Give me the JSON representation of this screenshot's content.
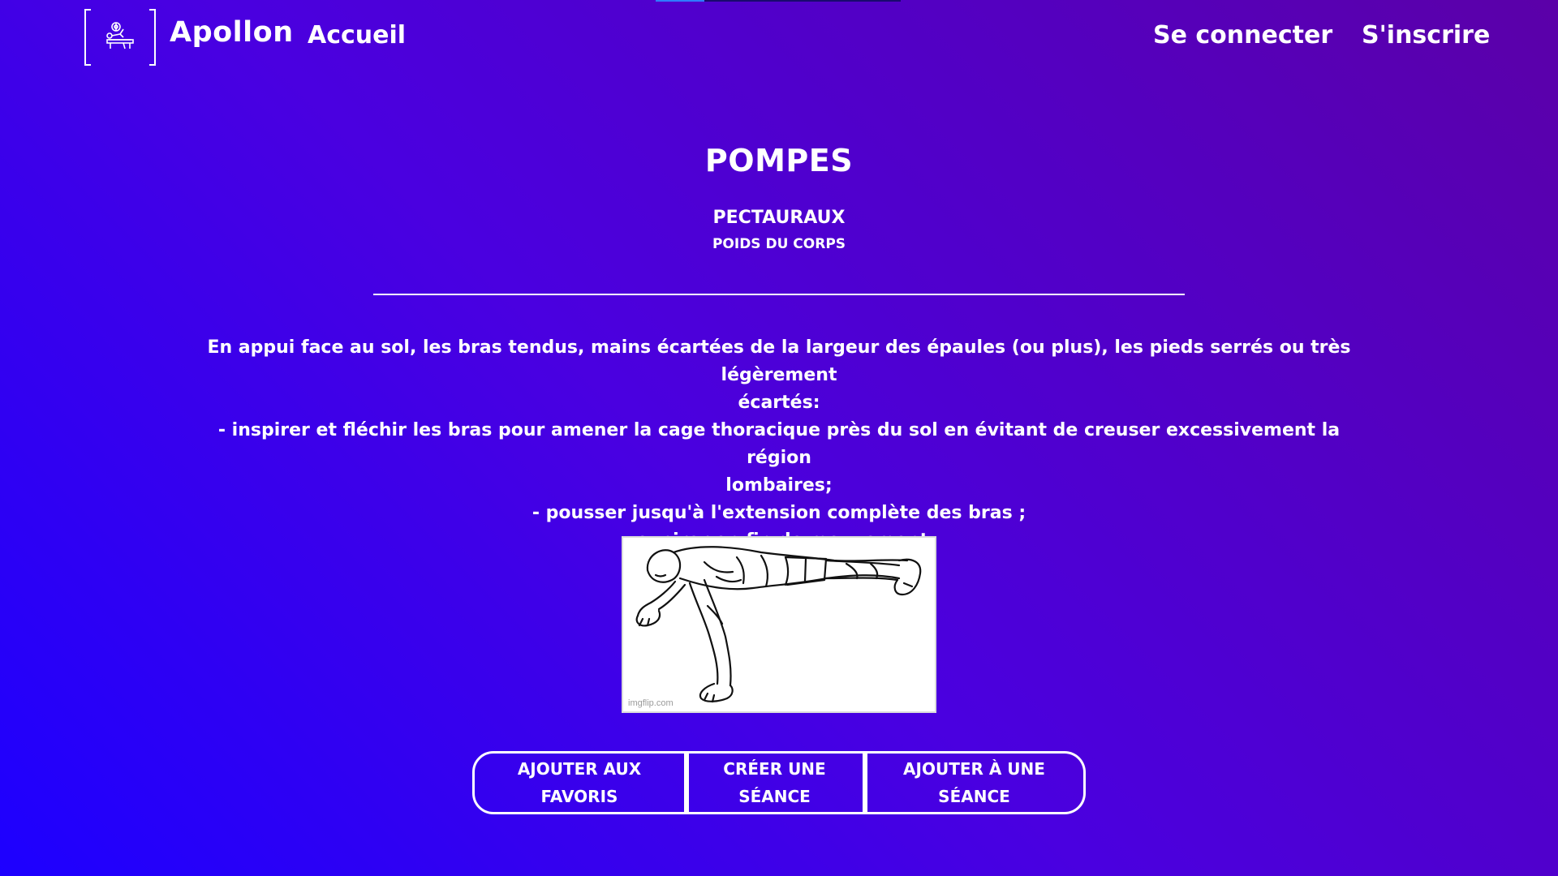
{
  "header": {
    "brand": "Apollon",
    "logo_icon": "bench-press-icon",
    "nav_home": "Accueil",
    "nav_login": "Se connecter",
    "nav_signup": "S'inscrire"
  },
  "loading_bar": {
    "progress": 0.2
  },
  "exercise": {
    "title": "POMPES",
    "muscle": "PECTAURAUX",
    "equipment": "POIDS DU CORPS",
    "description": [
      "En appui face au sol, les bras tendus, mains écartées de la largeur des épaules (ou plus), les pieds serrés ou très légèrement",
      "écartés:",
      "- inspirer et fléchir les bras pour amener la cage thoracique près du sol en évitant de creuser excessivement la région",
      "lombaires;",
      "- pousser jusqu'à l'extension complète des bras ;",
      "- expirer en fin de mouvement."
    ],
    "image_watermark": "imgflip.com"
  },
  "actions": {
    "add_favorites_line1": "AJOUTER AUX",
    "add_favorites_line2": "FAVORIS",
    "create_session_line1": "CRÉER UNE",
    "create_session_line2": "SÉANCE",
    "add_to_session_line1": "AJOUTER À UNE",
    "add_to_session_line2": "SÉANCE"
  },
  "colors": {
    "gradient_start": "#1d00ff",
    "gradient_mid": "#4a00e0",
    "gradient_end": "#5b00a8",
    "text": "#ffffff"
  }
}
